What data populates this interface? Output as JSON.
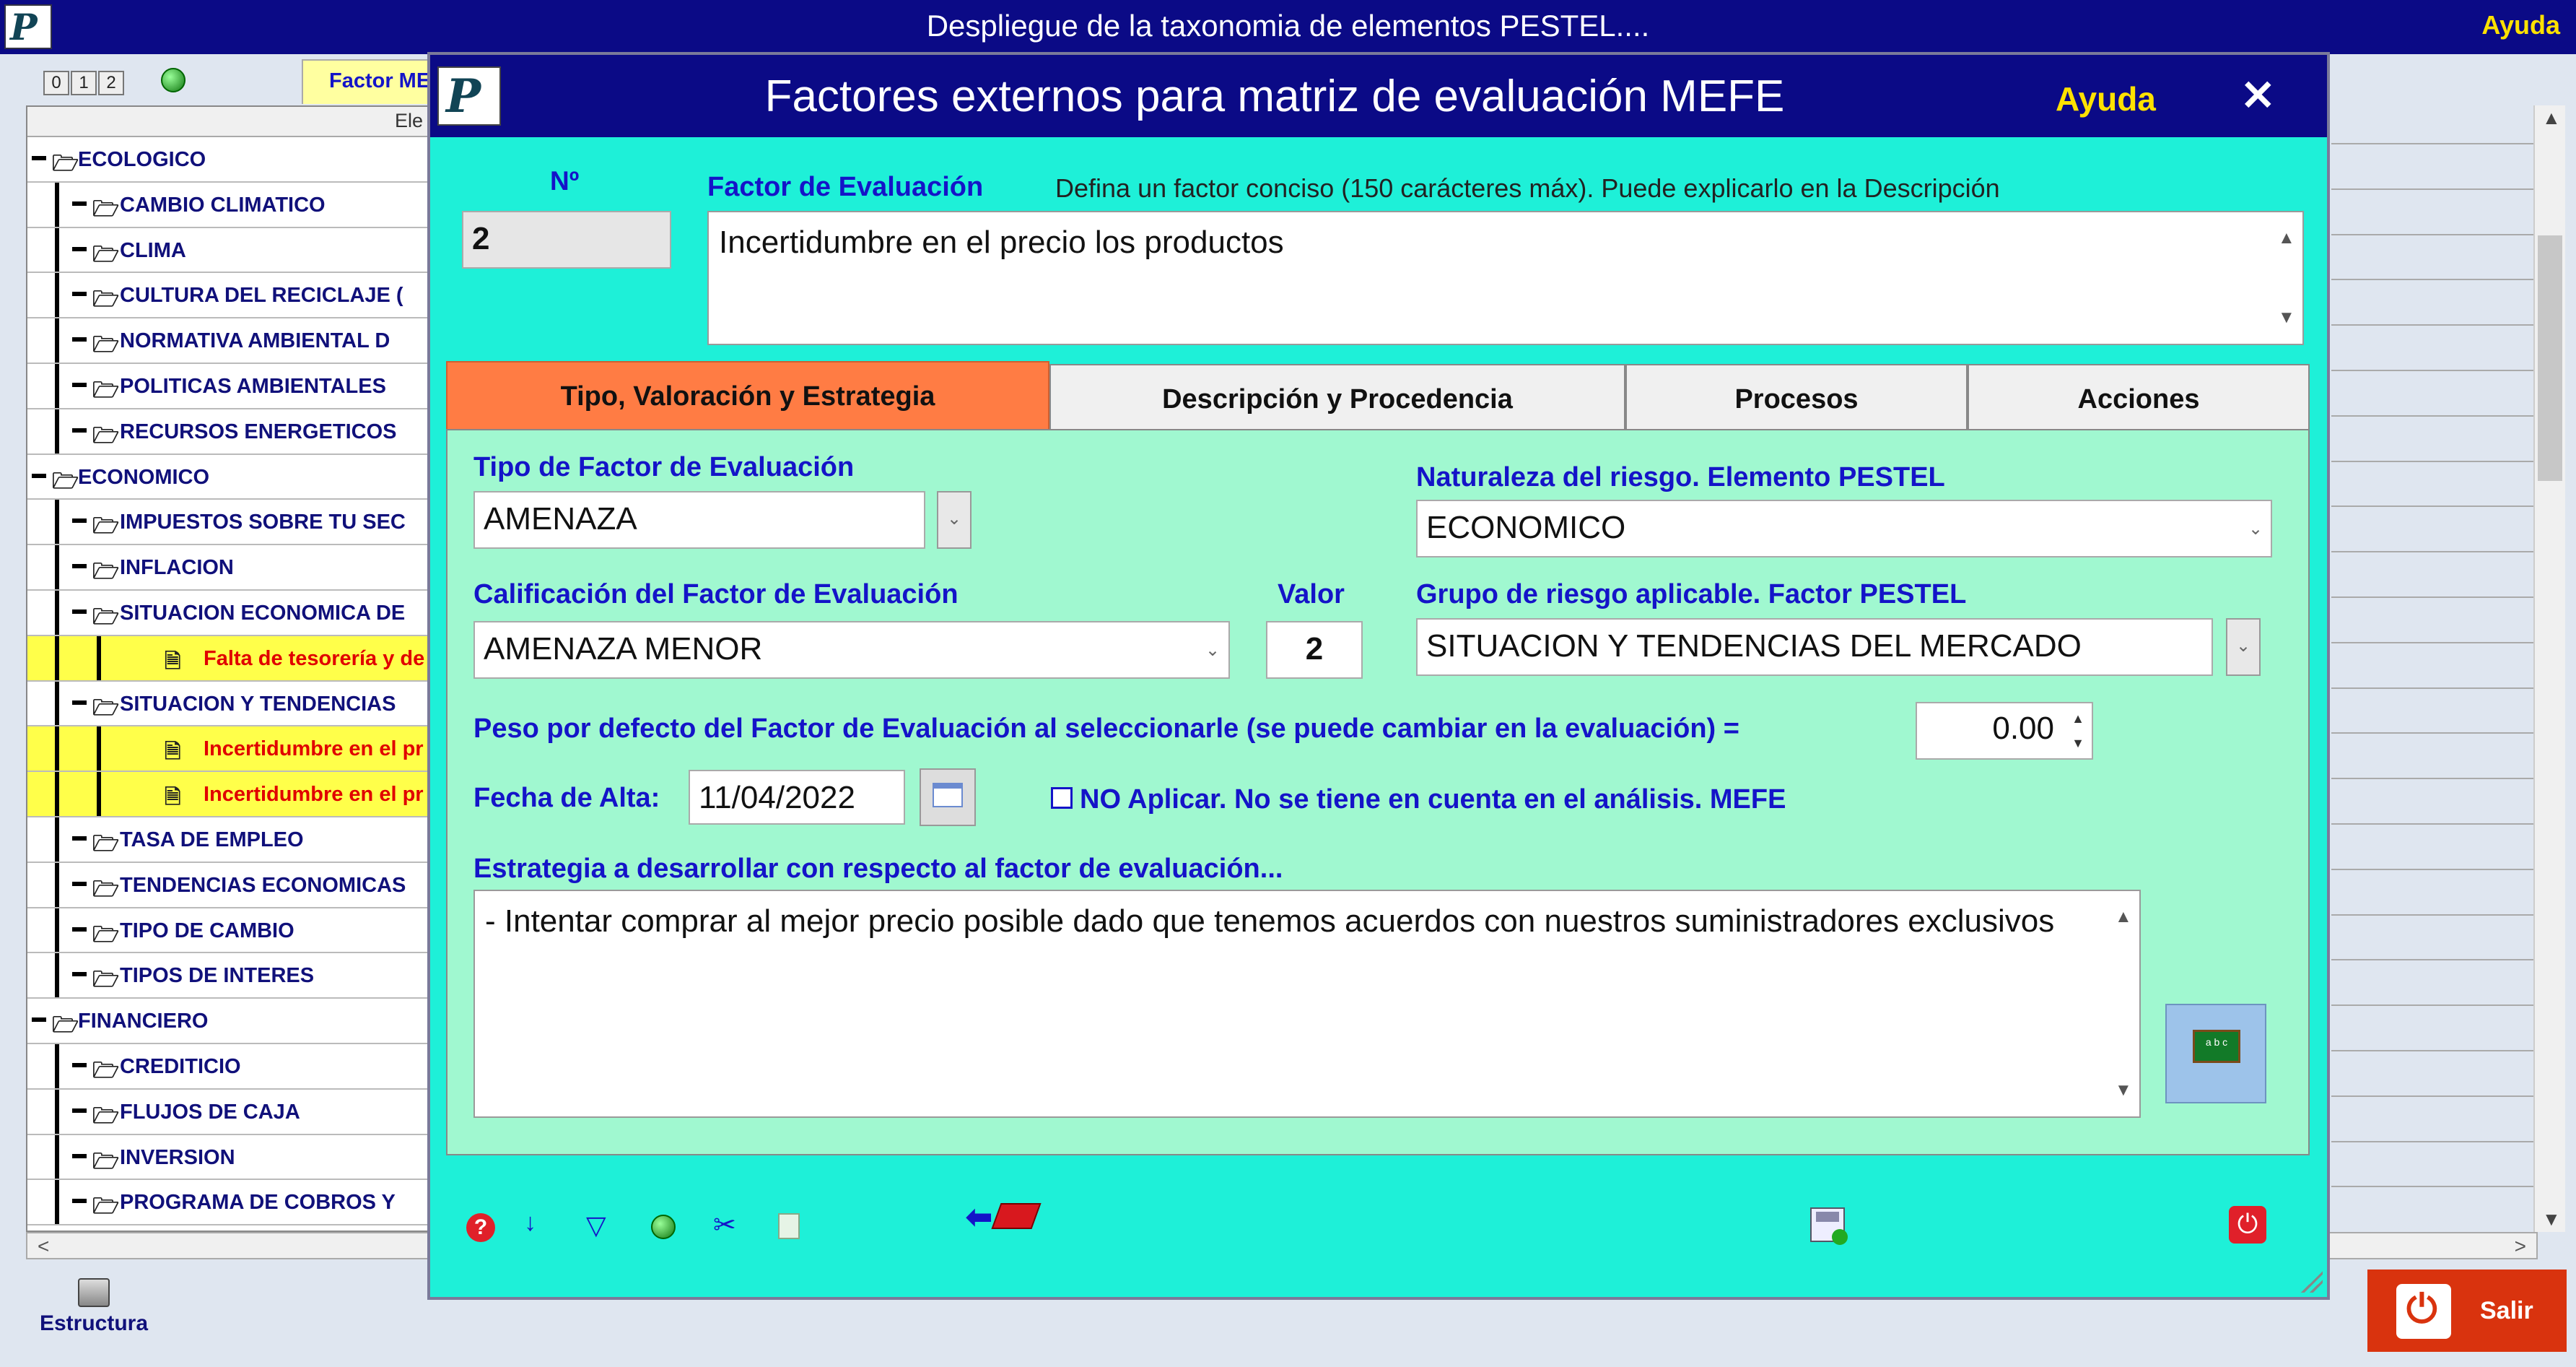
{
  "main": {
    "title": "Despliegue de la taxonomia de elementos PESTEL....",
    "help": "Ayuda",
    "level_buttons": [
      "0",
      "1",
      "2"
    ],
    "tab_label": "Factor ME",
    "tree_header": "Ele",
    "tree": [
      {
        "label": "ECOLOGICO",
        "kind": "group"
      },
      {
        "label": "CAMBIO CLIMATICO",
        "kind": "sub"
      },
      {
        "label": "CLIMA",
        "kind": "sub"
      },
      {
        "label": "CULTURA DEL RECICLAJE (",
        "kind": "sub"
      },
      {
        "label": "NORMATIVA AMBIENTAL D",
        "kind": "sub"
      },
      {
        "label": "POLITICAS AMBIENTALES",
        "kind": "sub"
      },
      {
        "label": "RECURSOS ENERGETICOS",
        "kind": "sub"
      },
      {
        "label": "ECONOMICO",
        "kind": "group"
      },
      {
        "label": "IMPUESTOS SOBRE TU SEC",
        "kind": "sub"
      },
      {
        "label": "INFLACION",
        "kind": "sub"
      },
      {
        "label": "SITUACION ECONOMICA DE",
        "kind": "sub"
      },
      {
        "label": "Falta de tesorería y de",
        "kind": "leaf"
      },
      {
        "label": "SITUACION Y TENDENCIAS",
        "kind": "sub"
      },
      {
        "label": "Incertidumbre en el pr",
        "kind": "leaf"
      },
      {
        "label": "Incertidumbre en el pr",
        "kind": "leaf"
      },
      {
        "label": "TASA DE EMPLEO",
        "kind": "sub"
      },
      {
        "label": "TENDENCIAS ECONOMICAS",
        "kind": "sub"
      },
      {
        "label": "TIPO DE CAMBIO",
        "kind": "sub"
      },
      {
        "label": "TIPOS DE INTERES",
        "kind": "sub"
      },
      {
        "label": "FINANCIERO",
        "kind": "group"
      },
      {
        "label": "CREDITICIO",
        "kind": "sub"
      },
      {
        "label": "FLUJOS DE CAJA",
        "kind": "sub"
      },
      {
        "label": "INVERSION",
        "kind": "sub"
      },
      {
        "label": "PROGRAMA DE COBROS Y",
        "kind": "sub"
      }
    ],
    "estructura_label": "Estructura",
    "salir_label": "Salir"
  },
  "dialog": {
    "title": "Factores externos para matriz de evaluación MEFE",
    "help": "Ayuda",
    "close": "✕",
    "num_label": "Nº",
    "num_value": "2",
    "factor_label": "Factor de Evaluación",
    "factor_hint": "Defina un factor conciso (150 carácteres máx). Puede explicarlo en la Descripción",
    "factor_value": "Incertidumbre en el precio los productos",
    "tabs": [
      "Tipo, Valoración y Estrategia",
      "Descripción y Procedencia",
      "Procesos",
      "Acciones"
    ],
    "tipo_label": "Tipo de Factor de Evaluación",
    "tipo_value": "AMENAZA",
    "naturaleza_label": "Naturaleza del riesgo. Elemento PESTEL",
    "naturaleza_value": "ECONOMICO",
    "calificacion_label": "Calificación del Factor de Evaluación",
    "calificacion_value": "AMENAZA MENOR",
    "valor_label": "Valor",
    "valor_value": "2",
    "grupo_label": "Grupo de riesgo aplicable. Factor PESTEL",
    "grupo_value": "SITUACION Y TENDENCIAS DEL MERCADO",
    "peso_label": "Peso por defecto del Factor de Evaluación al seleccionarle (se puede cambiar en la evaluación) =",
    "peso_value": "0.00",
    "fecha_label": "Fecha de Alta:",
    "fecha_value": "11/04/2022",
    "no_aplicar_label": "NO Aplicar. No se tiene en cuenta en el análisis. MEFE",
    "no_aplicar_checked": false,
    "estrategia_label": "Estrategia a desarrollar con respecto al factor de evaluación...",
    "estrategia_value": "- Intentar comprar al mejor precio posible dado que tenemos acuerdos con nuestros suministradores exclusivos",
    "abc_text": "a b c"
  },
  "colors": {
    "titlebar": "#0b0a86",
    "help_yellow": "#ffe100",
    "dialog_bg": "#1ef0d8",
    "panel_bg": "#a0f8d0",
    "active_tab": "#ff7c44",
    "label_blue": "#1414c8",
    "leaf_highlight": "#ffff4a",
    "salir_red": "#d9330e"
  },
  "icons": {
    "toolbar": [
      "help-icon",
      "sort-icon",
      "filter-icon",
      "globe-icon",
      "scissors-icon",
      "export-icon"
    ],
    "nav": "back-book-icon",
    "save": "save-icon",
    "power": "power-icon"
  }
}
